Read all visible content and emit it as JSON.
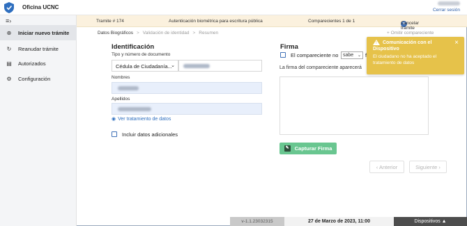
{
  "app": {
    "title": "Oficina UCNC",
    "user_name": "",
    "logout_label": "Cerrar sesión"
  },
  "sidebar": {
    "items": [
      {
        "icon": "plus-circle-icon",
        "label": "Iniciar nuevo trámite",
        "active": true
      },
      {
        "icon": "refresh-icon",
        "label": "Reanudar trámite",
        "active": false
      },
      {
        "icon": "document-icon",
        "label": "Autorizados",
        "active": false
      },
      {
        "icon": "gear-icon",
        "label": "Configuración",
        "active": false
      }
    ]
  },
  "procedure": {
    "id": "Tramite # 174",
    "description": "Autenticación biométrica para escritura pública",
    "counter": "Comparecientes 1 de 1",
    "cancel_label": "Cancelar trámite"
  },
  "steps": {
    "items": [
      "Datos Biográficos",
      "Validación de identidad",
      "Resumen"
    ],
    "separator": ">",
    "extra_link": "+ Omitir compareciente"
  },
  "identification": {
    "title": "Identificación",
    "doc_label": "Tipo y número de documento",
    "doc_type": "Cédula de Ciudadanía...",
    "names_label": "Nombres",
    "surnames_label": "Apellidos",
    "ver_link": "Ver tratamiento de datos",
    "additional_data_label": "Incluir datos adicionales"
  },
  "signature": {
    "title": "Firma",
    "checkbox_label_prefix": "El compareciente no",
    "select_value": "sabe",
    "checkbox_label_suffix": "f",
    "info_text": "La firma del compareciente aparecerá",
    "capture_label": "Capturar Firma"
  },
  "navigation": {
    "prev_label": "‹ Anterior",
    "next_label": "Siguiente ›"
  },
  "notification": {
    "title": "Comunicación con el Dispositivo",
    "body": "El ciudadano no ha aceptado el tratamiento de datos",
    "accent_color": "#e6c24a"
  },
  "footer": {
    "version": "v-1.1.23032315",
    "date": "27 de Marzo de 2023, 11:00",
    "devices_label": "Dispositivos ▲"
  }
}
